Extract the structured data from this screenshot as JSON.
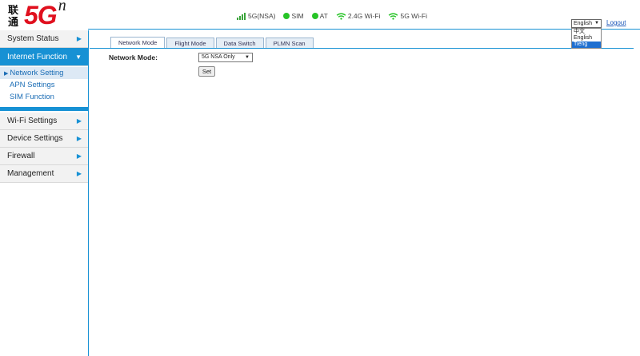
{
  "logo": {
    "cn": "联通",
    "big": "5G",
    "sup": "n"
  },
  "status": [
    {
      "icon": "signal-icon",
      "label": "5G(NSA)"
    },
    {
      "icon": "sim-status-dot-icon",
      "label": "SIM"
    },
    {
      "icon": "at-status-dot-icon",
      "label": "AT"
    },
    {
      "icon": "wifi-icon",
      "label": "2.4G Wi-Fi"
    },
    {
      "icon": "wifi-icon",
      "label": "5G Wi-Fi"
    }
  ],
  "language": {
    "selected": "English",
    "options": [
      "中文",
      "English",
      "Tiếng"
    ]
  },
  "logout": "Logout",
  "sidebar": {
    "system_status": "System Status",
    "internet_function": "Internet Function",
    "sub_items": [
      "Network Setting",
      "APN Settings",
      "SIM Function"
    ],
    "wifi_settings": "Wi-Fi Settings",
    "device_settings": "Device Settings",
    "firewall": "Firewall",
    "management": "Management"
  },
  "tabs": [
    "Network Mode",
    "Flight Mode",
    "Data Switch",
    "PLMN Scan"
  ],
  "form": {
    "label": "Network Mode:",
    "value": "5G NSA Only",
    "set_label": "Set"
  },
  "colors": {
    "accent": "#1791d4",
    "brand_red": "#e0101e",
    "status_green": "#27c427"
  }
}
